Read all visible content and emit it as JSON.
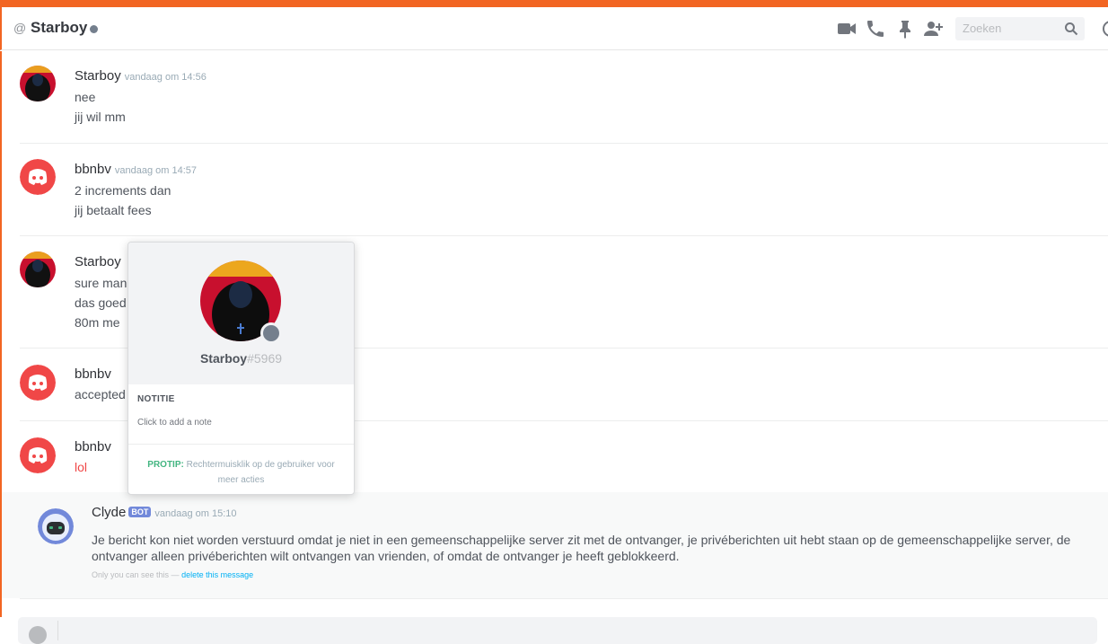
{
  "header": {
    "at_symbol": "@",
    "dm_name": "Starboy",
    "search_placeholder": "Zoeken",
    "icons": [
      "video-call-icon",
      "phone-icon",
      "pin-icon",
      "add-friend-icon",
      "search-icon",
      "at-icon"
    ]
  },
  "messages": [
    {
      "author": "Starboy",
      "timestamp": "vandaag om 14:56",
      "avatar": "starboy-avatar",
      "lines": [
        "nee",
        "jij wil mm"
      ]
    },
    {
      "author": "bbnbv",
      "timestamp": "vandaag om 14:57",
      "avatar": "discord-logo-avatar",
      "lines": [
        "2 increments dan",
        "jij betaalt fees"
      ]
    },
    {
      "author": "Starboy",
      "avatar": "starboy-avatar",
      "lines": [
        "sure man",
        "das goed",
        "80m me"
      ]
    },
    {
      "author": "bbnbv",
      "avatar": "discord-logo-avatar",
      "lines": [
        "accepted"
      ]
    },
    {
      "author": "bbnbv",
      "avatar": "discord-logo-avatar",
      "lines": [
        "lol"
      ]
    }
  ],
  "clyde": {
    "name": "Clyde",
    "tag": "BOT",
    "timestamp": "vandaag om 15:10",
    "text": "Je bericht kon niet worden verstuurd omdat je niet in een gemeenschappelijke server zit met de ontvanger, je privéberichten uit hebt staan op de gemeenschappelijke server, de ontvanger alleen privéberichten wilt ontvangen van vrienden, of omdat de ontvanger je heeft geblokkeerd.",
    "footer_prefix": "Only you can see this —",
    "footer_link": "delete this message"
  },
  "popout": {
    "username": "Starboy",
    "discriminator": "#5969",
    "note_title": "NOTITIE",
    "note_placeholder": "Click to add a note",
    "protip_label": "PROTIP:",
    "protip_text": "Rechtermuisklik op de gebruiker voor meer acties"
  },
  "colors": {
    "accent_orange": "#f26522",
    "blurple": "#7289da",
    "discord_red": "#f04747",
    "protip_green": "#43b581"
  }
}
